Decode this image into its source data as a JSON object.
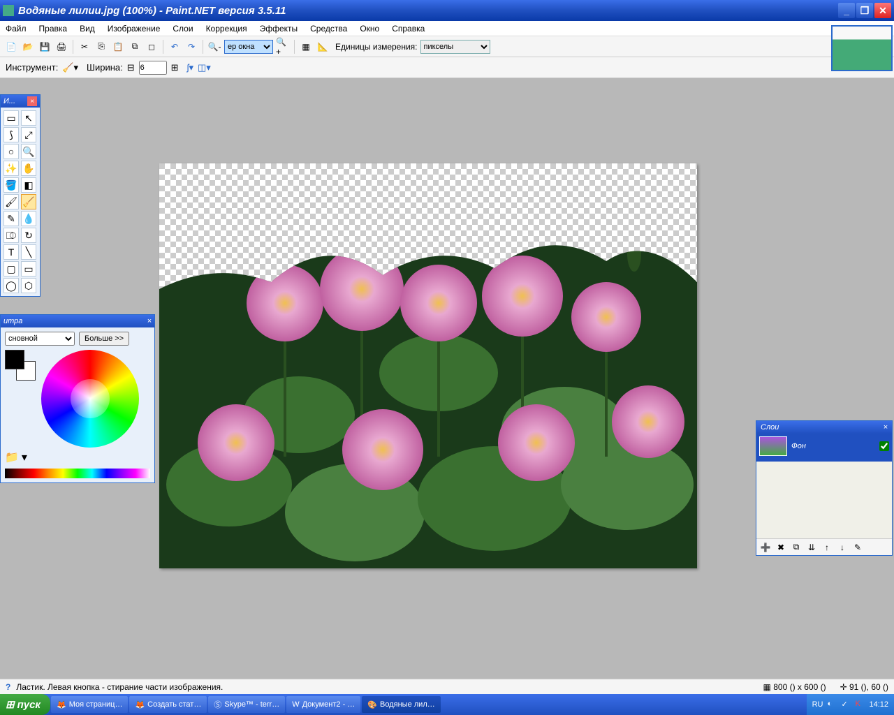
{
  "titlebar": {
    "title": "Водяные лилии.jpg (100%) - Paint.NET версия 3.5.11"
  },
  "menu": {
    "file": "Файл",
    "edit": "Правка",
    "view": "Вид",
    "image": "Изображение",
    "layers": "Слои",
    "adjust": "Коррекция",
    "effects": "Эффекты",
    "tools": "Средства",
    "window": "Окно",
    "help": "Справка"
  },
  "toolbar1": {
    "zoom_value": "ер окна",
    "units_label": "Единицы измерения:",
    "units_value": "пикселы"
  },
  "toolbar2": {
    "instrument_label": "Инструмент:",
    "width_label": "Ширина:",
    "width_value": "6"
  },
  "tools_window": {
    "title": "И..."
  },
  "colors_window": {
    "title": "итра",
    "primary_label": "сновной",
    "more_btn": "Больше >>"
  },
  "layers_window": {
    "title": "Слои",
    "layer_name": "Фон"
  },
  "statusbar": {
    "help_icon": "?",
    "message": "Ластик. Левая кнопка - стирание части изображения.",
    "dimensions": "800 () x 600 ()",
    "cursor": "91 (), 60 ()"
  },
  "taskbar": {
    "start": "пуск",
    "items": [
      "Моя страниц…",
      "Создать стат…",
      "Skype™ - terr…",
      "Документ2 - …",
      "Водяные лил…"
    ],
    "lang": "RU",
    "time": "14:12"
  }
}
